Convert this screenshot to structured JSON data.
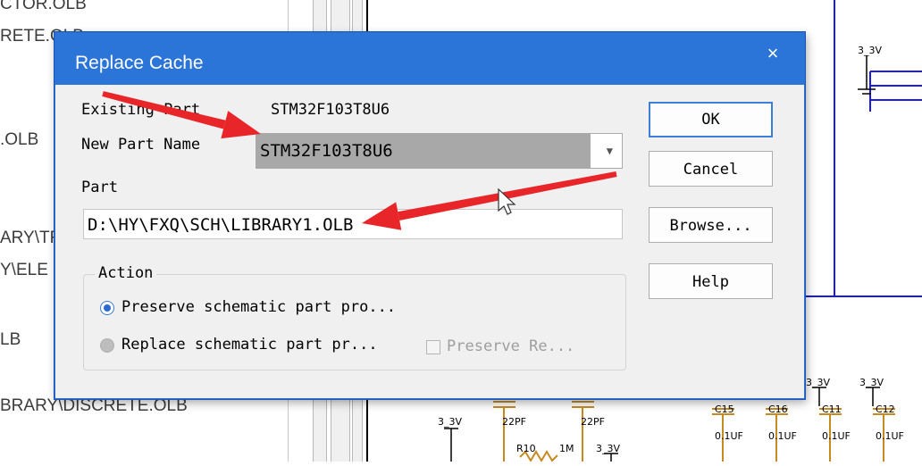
{
  "background": {
    "tree_items": [
      {
        "text": "CTOR.OLB"
      },
      {
        "text": "RETE.OLB"
      },
      {
        "text": ".OLB"
      },
      {
        "text": "ARY\\TR"
      },
      {
        "text": "Y\\ELE"
      },
      {
        "text": "LB"
      },
      {
        "text": "BRARY\\DISCRETE.OLB"
      }
    ],
    "schematic_labels": {
      "v1": "3_3V",
      "v2": "3_3V",
      "v3": "3_3V",
      "v4": "3_3V",
      "v5": "3_3V",
      "cap1": "22PF",
      "cap2": "22PF",
      "r10": "R10",
      "r10_val": "1M",
      "c15": "C15",
      "c16": "C16",
      "c11": "C11",
      "c12": "C12",
      "uf1": "0.1UF",
      "uf2": "0.1UF",
      "uf3": "0.1UF",
      "uf4": "0.1UF"
    }
  },
  "dialog": {
    "title": "Replace Cache",
    "close_glyph": "×",
    "existing_part_label": "Existing Part",
    "existing_part_value": "STM32F103T8U6",
    "new_part_name_label": "New Part Name",
    "new_part_name_value": "STM32F103T8U6",
    "part_library_label": "Part",
    "part_library_value": "D:\\HY\\FXQ\\SCH\\LIBRARY1.OLB",
    "buttons": {
      "ok": "OK",
      "cancel": "Cancel",
      "browse": "Browse...",
      "help": "Help"
    },
    "action_group_label": "Action",
    "option_preserve": "Preserve schematic part pro...",
    "option_replace": "Replace schematic part pr...",
    "option_preserve_refs": "Preserve Re...",
    "selected_option": "preserve"
  },
  "annotations": {
    "arrow_color": "#e8262a"
  }
}
